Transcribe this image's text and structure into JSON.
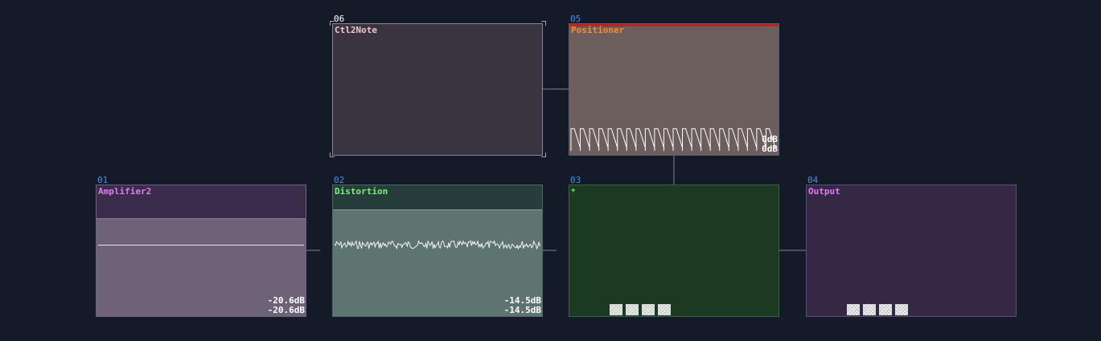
{
  "colors": {
    "background": "#141a27",
    "index_label": "#4e8fd8",
    "amplifier_title": "#e27cf2",
    "distortion_title": "#7cf27a",
    "output_title": "#e27cf2",
    "positioner_title": "#ff8a2a",
    "ctl2note_title": "#f0c8cc",
    "positioner_bar": "#c02020"
  },
  "modules": {
    "ctl2note": {
      "index": "06",
      "title": "Ctl2Note"
    },
    "positioner": {
      "index": "05",
      "title": "Positioner",
      "level_top": "0dB",
      "level_bottom": "0dB"
    },
    "amplifier": {
      "index": "01",
      "title": "Amplifier2",
      "level_top": "-20.6dB",
      "level_bottom": "-20.6dB",
      "bar_level": 0.74
    },
    "distortion": {
      "index": "02",
      "title": "Distortion",
      "level_top": "-14.5dB",
      "level_bottom": "-14.5dB",
      "bar_level": 0.81
    },
    "mixer": {
      "index": "03",
      "title": "+"
    },
    "output": {
      "index": "04",
      "title": "Output"
    }
  }
}
